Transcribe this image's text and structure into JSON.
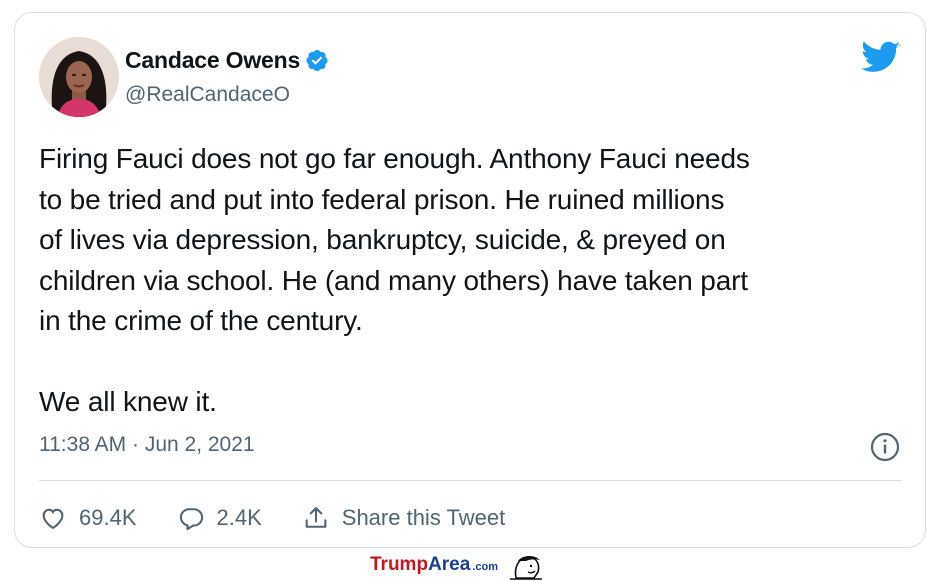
{
  "author": {
    "display_name": "Candace Owens",
    "handle": "@RealCandaceO",
    "avatar_icon": "profile-photo",
    "verified_icon": "verified-badge-icon"
  },
  "tweet": {
    "text": "Firing Fauci does not go far enough. Anthony Fauci needs\nto be tried and put into federal prison. He ruined millions\nof lives via depression, bankruptcy, suicide, & preyed on\nchildren via school. He (and many others) have taken part\nin the crime of the century.\n\nWe all knew it.",
    "timestamp": "11:38 AM · Jun 2, 2021"
  },
  "actions": {
    "like_count": "69.4K",
    "reply_count": "2.4K",
    "share_label": "Share this Tweet"
  },
  "watermark": {
    "brand_trump": "TrumpArea",
    "brand_dotcom": ".com"
  },
  "colors": {
    "twitter_blue": "#1d9bf0",
    "text": "#0f1419",
    "secondary": "#536471",
    "border": "#d6dde3"
  }
}
